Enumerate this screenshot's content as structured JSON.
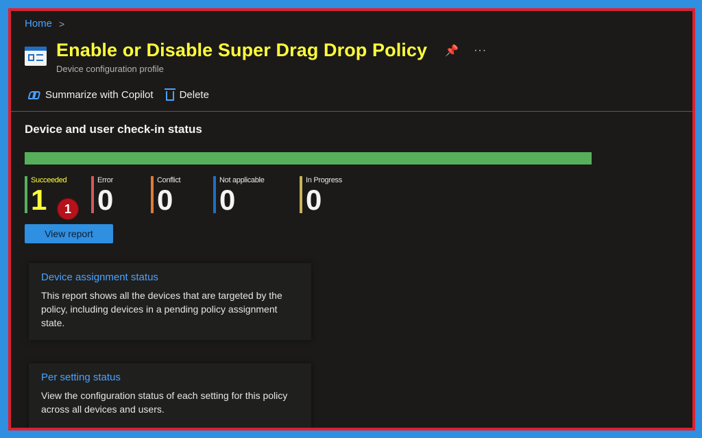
{
  "breadcrumb": {
    "home": "Home",
    "chevron": ">"
  },
  "header": {
    "title": "Enable or Disable Super Drag Drop Policy",
    "subtitle": "Device configuration profile",
    "pin_glyph": "📌",
    "more_glyph": "···"
  },
  "toolbar": {
    "copilot_label": "Summarize with Copilot",
    "delete_label": "Delete"
  },
  "status": {
    "title": "Device and user check-in status",
    "progress_fraction": 1.0,
    "stats": [
      {
        "label": "Succeeded",
        "value": "1",
        "color": "#56b05a"
      },
      {
        "label": "Error",
        "value": "0",
        "color": "#d35a5a"
      },
      {
        "label": "Conflict",
        "value": "0",
        "color": "#e07b39"
      },
      {
        "label": "Not applicable",
        "value": "0",
        "color": "#1f6fc4"
      },
      {
        "label": "In Progress",
        "value": "0",
        "color": "#c9b45a"
      }
    ],
    "badge": "1",
    "view_report_label": "View report"
  },
  "cards": [
    {
      "title": "Device assignment status",
      "description": "This report shows all the devices that are targeted by the policy, including devices in a pending policy assignment state."
    },
    {
      "title": "Per setting status",
      "description": "View the configuration status of each setting for this policy across all devices and users."
    }
  ],
  "colors": {
    "accent": "#2f8fe0",
    "link": "#4aa3ff",
    "highlight": "#ffff3a",
    "frame": "#e0202e",
    "progress": "#56b05a"
  }
}
